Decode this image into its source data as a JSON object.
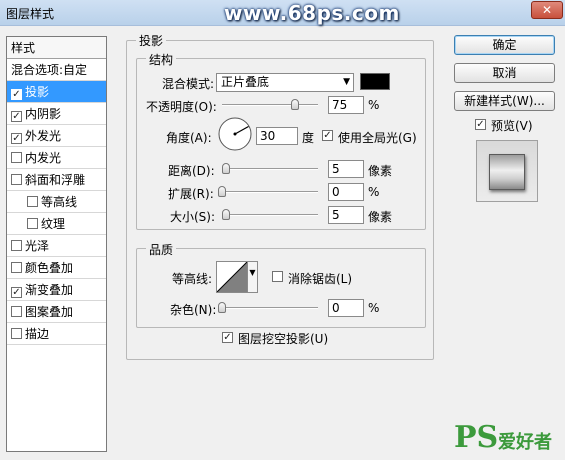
{
  "window": {
    "title": "图层样式",
    "watermark": "www.68ps.com",
    "close_label": "✕"
  },
  "styles": {
    "header": "样式",
    "blend_options": "混合选项:自定",
    "items": [
      {
        "label": "投影",
        "checked": true,
        "selected": true
      },
      {
        "label": "内阴影",
        "checked": true
      },
      {
        "label": "外发光",
        "checked": true
      },
      {
        "label": "内发光",
        "checked": false
      },
      {
        "label": "斜面和浮雕",
        "checked": false
      },
      {
        "label": "等高线",
        "checked": false,
        "indent": true
      },
      {
        "label": "纹理",
        "checked": false,
        "indent": true
      },
      {
        "label": "光泽",
        "checked": false
      },
      {
        "label": "颜色叠加",
        "checked": false
      },
      {
        "label": "渐变叠加",
        "checked": true
      },
      {
        "label": "图案叠加",
        "checked": false
      },
      {
        "label": "描边",
        "checked": false
      }
    ]
  },
  "drop_shadow": {
    "title": "投影",
    "structure": {
      "title": "结构",
      "blend_mode_label": "混合模式:",
      "blend_mode_value": "正片叠底",
      "color": "#000000",
      "opacity_label": "不透明度(O):",
      "opacity_value": "75",
      "opacity_unit": "%",
      "opacity_fraction": 0.75,
      "angle_label": "角度(A):",
      "angle_value": "30",
      "angle_unit": "度",
      "global_light_label": "使用全局光(G)",
      "global_light_checked": true,
      "distance_label": "距离(D):",
      "distance_value": "5",
      "distance_unit": "像素",
      "spread_label": "扩展(R):",
      "spread_value": "0",
      "spread_unit": "%",
      "size_label": "大小(S):",
      "size_value": "5",
      "size_unit": "像素"
    },
    "quality": {
      "title": "品质",
      "contour_label": "等高线:",
      "anti_alias_label": "消除锯齿(L)",
      "anti_alias_checked": false,
      "noise_label": "杂色(N):",
      "noise_value": "0",
      "noise_unit": "%"
    },
    "knockout_label": "图层挖空投影(U)",
    "knockout_checked": true
  },
  "buttons": {
    "ok": "确定",
    "cancel": "取消",
    "new_style": "新建样式(W)...",
    "preview_label": "预览(V)",
    "preview_checked": true
  },
  "logo": {
    "ps": "PS",
    "text": "爱好者"
  },
  "colors": {
    "selection": "#3399ff",
    "title_bar": "#b9d1ea",
    "logo_green": "#3c9a3c"
  }
}
